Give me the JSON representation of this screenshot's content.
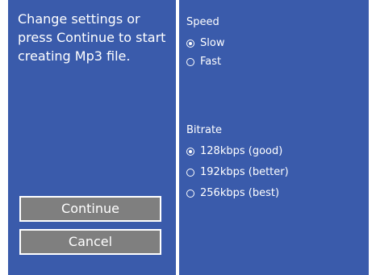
{
  "instructions": "Change settings or press Continue to start creating Mp3 file.",
  "buttons": {
    "continue_label": "Continue",
    "cancel_label": "Cancel"
  },
  "speed": {
    "title": "Speed",
    "options": [
      {
        "label": "Slow",
        "selected": true
      },
      {
        "label": "Fast",
        "selected": false
      }
    ]
  },
  "bitrate": {
    "title": "Bitrate",
    "options": [
      {
        "label": "128kbps (good)",
        "selected": true
      },
      {
        "label": "192kbps (better)",
        "selected": false
      },
      {
        "label": "256kbps (best)",
        "selected": false
      }
    ]
  },
  "colors": {
    "panel_background": "#3a5bab",
    "button_background": "#7f7f7f",
    "text": "#ffffff",
    "divider": "#ffffff"
  }
}
